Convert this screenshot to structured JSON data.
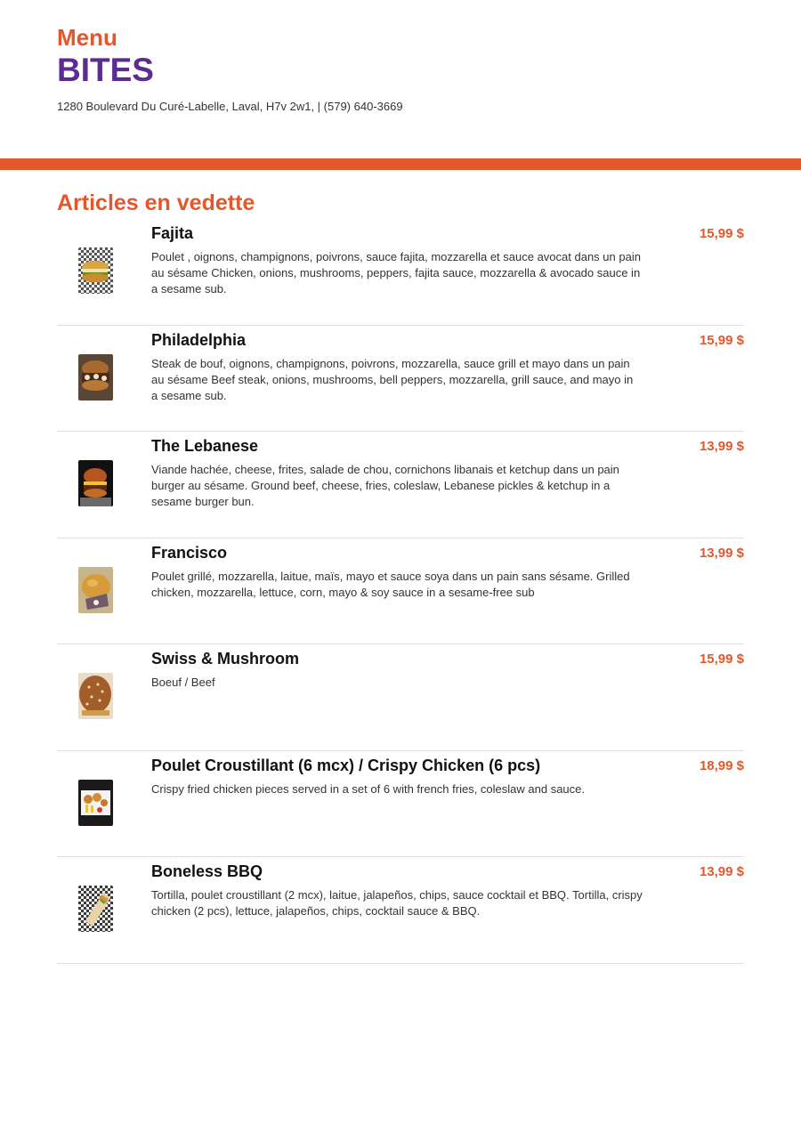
{
  "header": {
    "menu_label": "Menu",
    "brand": "BITES",
    "address": "1280 Boulevard Du Curé-Labelle, Laval, H7v 2w1, | (579) 640-3669"
  },
  "section": {
    "title": "Articles en vedette"
  },
  "items": [
    {
      "name": "Fajita",
      "price": "15,99 $",
      "description": "Poulet , oignons, champignons, poivrons, sauce fajita, mozzarella et sauce avocat dans un pain au sésame Chicken, onions, mushrooms, peppers, fajita sauce, mozzarella & avocado sauce in a sesame sub."
    },
    {
      "name": "Philadelphia",
      "price": "15,99 $",
      "description": "Steak de bouf, oignons, champignons, poivrons, mozzarella, sauce grill et mayo dans un pain au sésame Beef steak, onions, mushrooms, bell peppers, mozzarella, grill sauce, and mayo in a sesame sub."
    },
    {
      "name": "The Lebanese",
      "price": "13,99 $",
      "description": "Viande hachée, cheese, frites, salade de chou, cornichons libanais et ketchup dans un pain burger au sésame. Ground beef, cheese, fries, coleslaw, Lebanese pickles & ketchup in a sesame burger bun."
    },
    {
      "name": "Francisco",
      "price": "13,99 $",
      "description": "Poulet grillé, mozzarella, laitue, maïs, mayo et sauce soya dans un pain sans sésame. Grilled chicken, mozzarella, lettuce, corn, mayo & soy sauce in a sesame-free sub"
    },
    {
      "name": "Swiss & Mushroom",
      "price": "15,99 $",
      "description": "Boeuf / Beef"
    },
    {
      "name": "Poulet Croustillant (6 mcx) / Crispy Chicken (6 pcs)",
      "price": "18,99 $",
      "description": "Crispy fried chicken pieces served in a set of 6 with french fries, coleslaw and sauce."
    },
    {
      "name": "Boneless BBQ",
      "price": "13,99 $",
      "description": "Tortilla, poulet croustillant (2 mcx), laitue, jalapeños, chips, sauce cocktail et BBQ. Tortilla, crispy chicken (2 pcs), lettuce, jalapeños, chips, cocktail sauce & BBQ."
    }
  ]
}
